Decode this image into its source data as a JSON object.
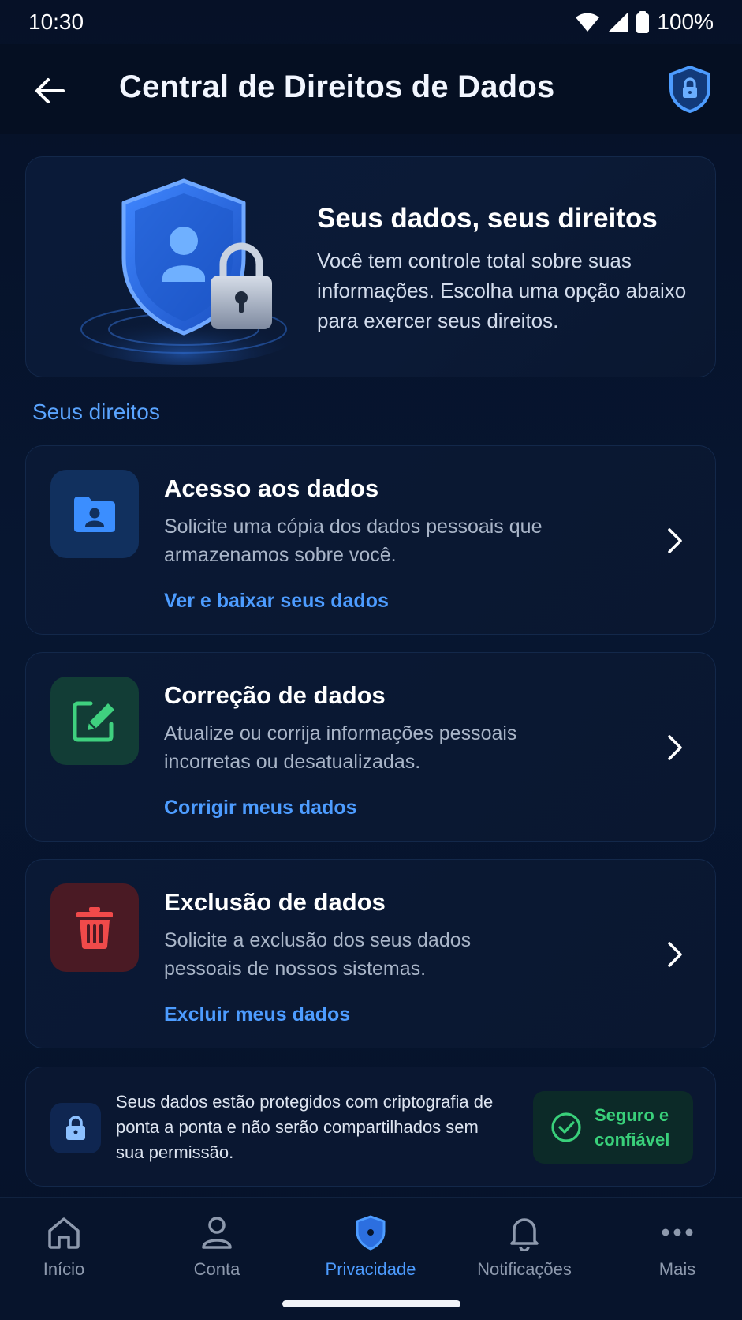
{
  "status_bar": {
    "time": "10:30",
    "battery": "100%"
  },
  "app_bar": {
    "title": "Central de Direitos de Dados"
  },
  "hero": {
    "title": "Seus dados, seus direitos",
    "description": "Você tem controle total sobre suas informações. Escolha uma opção abaixo para exercer seus direitos."
  },
  "section": {
    "label": "Seus direitos"
  },
  "rights": [
    {
      "title": "Acesso aos dados",
      "description": "Solicite uma cópia dos dados pessoais que armazenamos sobre você.",
      "link": "Ver e baixar seus dados",
      "icon": "folder-user-icon"
    },
    {
      "title": "Correção de dados",
      "description": "Atualize ou corrija informações pessoais incorretas ou desatualizadas.",
      "link": "Corrigir meus dados",
      "icon": "edit-icon"
    },
    {
      "title": "Exclusão de dados",
      "description": "Solicite a exclusão dos seus dados pessoais de nossos sistemas.",
      "link": "Excluir meus dados",
      "icon": "trash-icon"
    }
  ],
  "security": {
    "text": "Seus dados estão protegidos com criptografia de ponta a ponta e não serão compartilhados sem sua permissão.",
    "badge": "Seguro e confiável"
  },
  "bottom_nav": {
    "items": [
      {
        "label": "Início",
        "icon": "home-icon"
      },
      {
        "label": "Conta",
        "icon": "user-icon"
      },
      {
        "label": "Privacidade",
        "icon": "shield-icon",
        "active": true
      },
      {
        "label": "Notificações",
        "icon": "bell-icon"
      },
      {
        "label": "Mais",
        "icon": "more-icon"
      }
    ]
  },
  "colors": {
    "accent": "#4d9cff",
    "background": "#061127",
    "success": "#39d07a",
    "danger": "#f04a4a",
    "green_icon": "#3fd17f"
  }
}
